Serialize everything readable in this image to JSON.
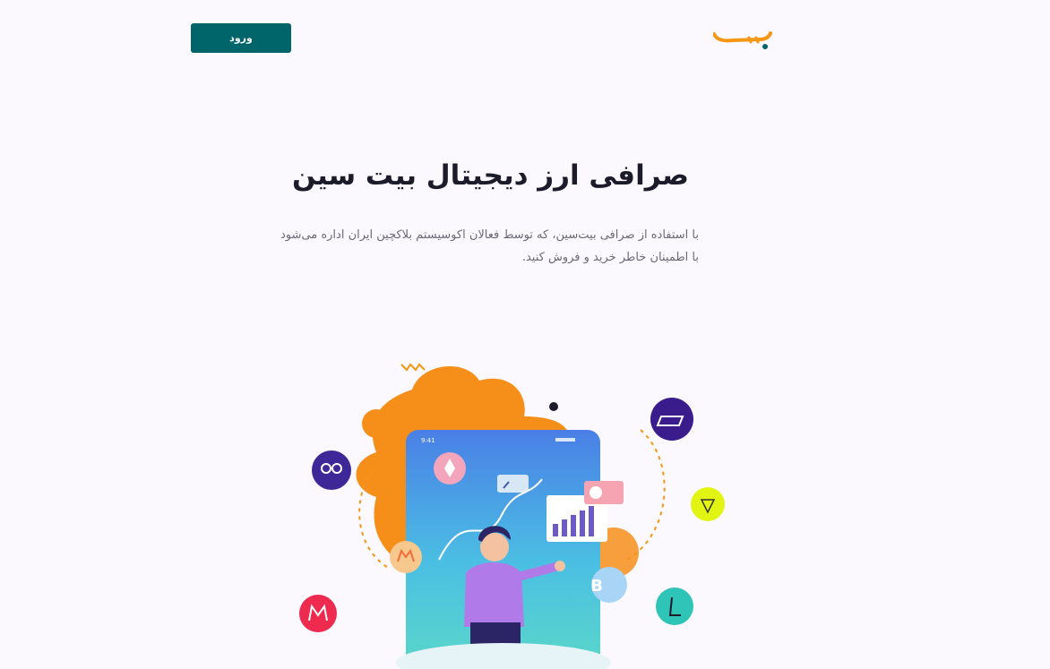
{
  "header": {
    "login_label": "ورود",
    "logo_icon": "bitsin-logo",
    "brand_color": "#00656a",
    "accent_color": "#f59713"
  },
  "hero": {
    "title": "صرافی ارز دیجیتال بیت سین",
    "description_line1": "با استفاده از صرافی بیت‌سین، که توسط فعالان اکوسیستم بلاکچین ایران اداره می‌شود",
    "description_line2": "با اطمینان خاطر خرید و فروش کنید.",
    "phone_time": "9:41",
    "coin_icons": [
      "dash-coin-icon",
      "ripple-coin-icon",
      "tron-coin-icon",
      "monero-coin-icon",
      "bitcoin-coin-icon",
      "litecoin-coin-icon",
      "monero-coin-icon",
      "ethereum-coin-icon"
    ]
  }
}
